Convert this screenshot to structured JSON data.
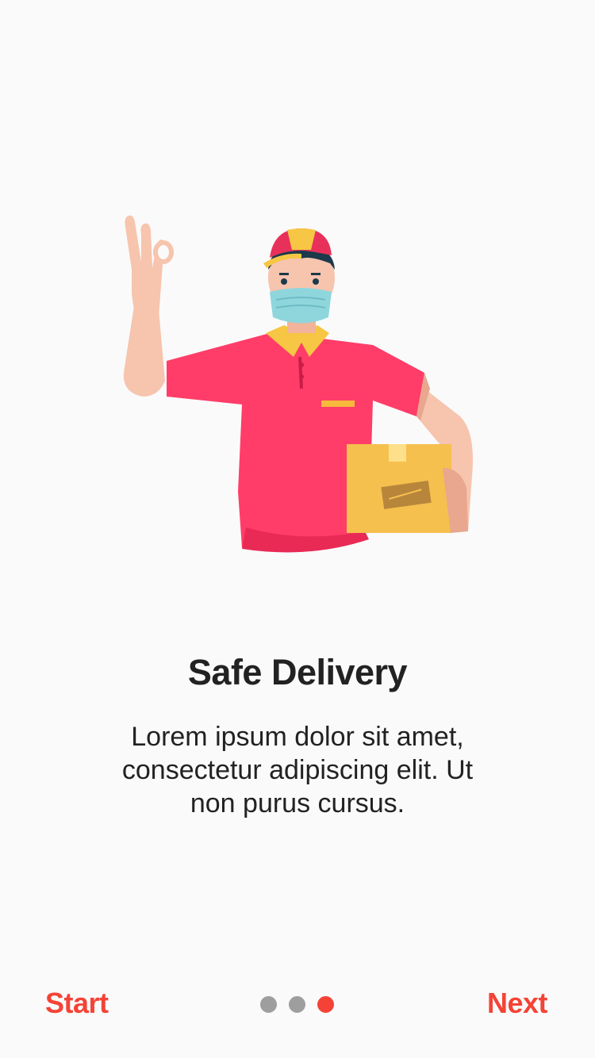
{
  "onboarding": {
    "title": "Safe Delivery",
    "description": "Lorem ipsum dolor sit amet, consectetur adipiscing elit. Ut non purus cursus.",
    "illustration_icon": "delivery-man-with-box-illustration"
  },
  "navigation": {
    "start_label": "Start",
    "next_label": "Next",
    "page_count": 3,
    "current_page": 3
  },
  "colors": {
    "accent": "#f44336",
    "dot_inactive": "#9e9e9e",
    "text": "#222222",
    "background": "#fafafa"
  }
}
